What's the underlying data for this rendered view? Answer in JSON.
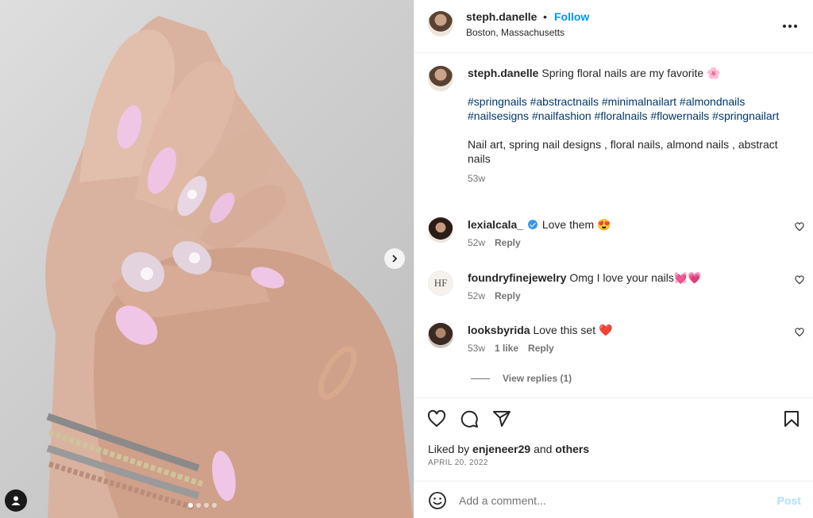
{
  "post": {
    "username": "steph.danelle",
    "separator": "•",
    "follow_label": "Follow",
    "location": "Boston, Massachusetts",
    "more_icon": "more-horizontal-icon",
    "carousel": {
      "total": 4,
      "current": 1
    },
    "caption": {
      "username": "steph.danelle",
      "text": "Spring floral nails are my favorite 🌸",
      "hashtags": "#springnails #abstractnails #minimalnailart #almondnails #nailsesigns #nailfashion #floralnails #flowernails #springnailart",
      "description": "Nail art, spring nail designs , floral nails, almond nails , abstract nails",
      "time": "53w"
    },
    "comments": [
      {
        "username": "lexialcala_",
        "verified": true,
        "text": "Love them 😍",
        "time": "52w",
        "likes": "",
        "reply_label": "Reply"
      },
      {
        "username": "foundryfinejewelry",
        "verified": false,
        "text": "Omg I love your nails💓💗",
        "time": "52w",
        "likes": "",
        "reply_label": "Reply",
        "avatar_text": "HF"
      },
      {
        "username": "looksbyrida",
        "verified": false,
        "text": "Love this set ❤️",
        "time": "53w",
        "likes": "1 like",
        "reply_label": "Reply"
      }
    ],
    "view_replies": "View replies (1)",
    "liked_by_prefix": "Liked by",
    "liked_by_user": "enjeneer29",
    "liked_by_and": "and",
    "liked_by_others": "others",
    "date": "APRIL 20, 2022",
    "add_comment_placeholder": "Add a comment...",
    "post_label": "Post"
  },
  "colors": {
    "accent": "#0095f6",
    "post_disabled": "#b2dffc",
    "hashtag": "#00376b",
    "nail": "#f0c9e6"
  }
}
